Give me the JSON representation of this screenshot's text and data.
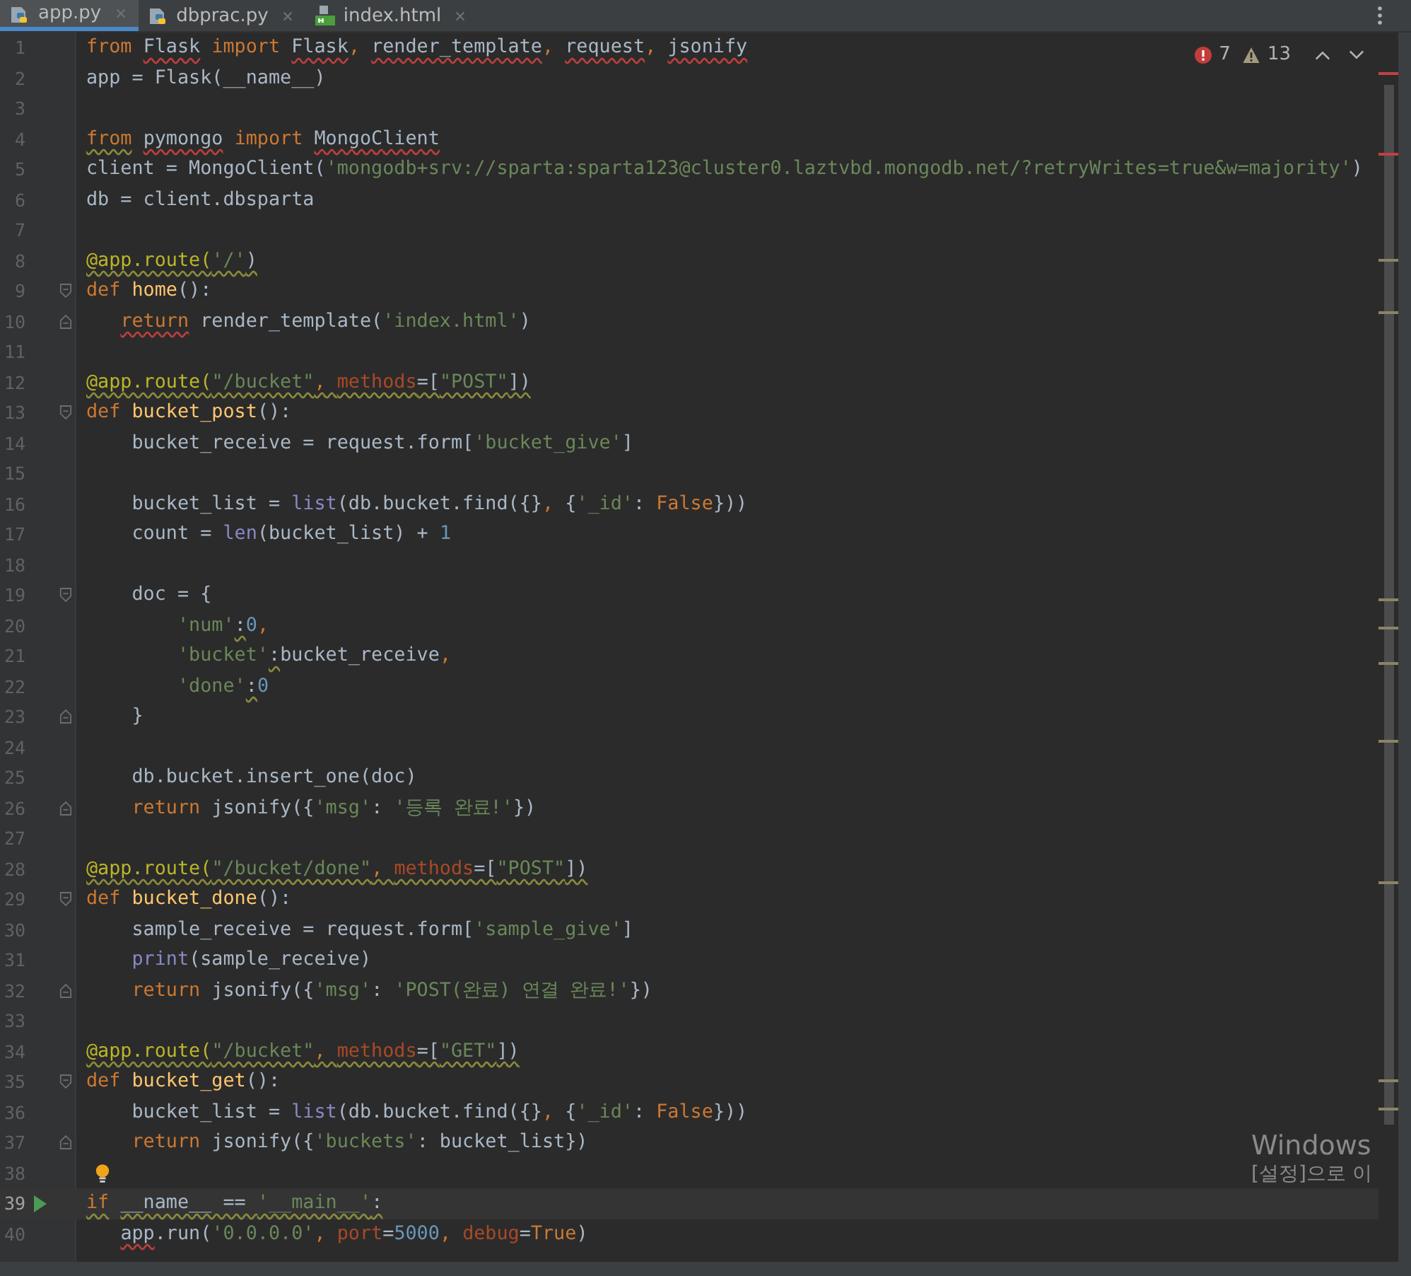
{
  "tabs": [
    {
      "label": "app.py",
      "kind": "python",
      "selected": true
    },
    {
      "label": "dbprac.py",
      "kind": "python",
      "selected": false
    },
    {
      "label": "index.html",
      "kind": "html",
      "selected": false
    }
  ],
  "inspections": {
    "errors": "7",
    "warnings": "13"
  },
  "lines": [
    {
      "number": "1",
      "current": false,
      "tokens": [
        {
          "text": "from",
          "kind": "kw"
        },
        {
          "text": " Flask",
          "kind": "plain",
          "error": true
        },
        {
          "text": " import",
          "kind": "kw"
        },
        {
          "text": " Flask",
          "kind": "plain",
          "error": true
        },
        {
          "text": ", ",
          "kind": "kw"
        },
        {
          "text": "render_template",
          "kind": "plain",
          "error": true
        },
        {
          "text": ", ",
          "kind": "kw"
        },
        {
          "text": "request",
          "kind": "plain",
          "error": true
        },
        {
          "text": ", ",
          "kind": "kw"
        },
        {
          "text": "jsonify",
          "kind": "plain",
          "error": true
        }
      ]
    },
    {
      "number": "2",
      "current": false,
      "tokens": [
        {
          "text": "app = Flask(__name__)",
          "kind": "plain"
        }
      ]
    },
    {
      "number": "3",
      "current": false
    },
    {
      "number": "4",
      "current": false,
      "tokens": [
        {
          "text": "from",
          "kind": "kw",
          "warning": true
        },
        {
          "text": " pymongo",
          "kind": "plain",
          "error": true
        },
        {
          "text": " import",
          "kind": "kw"
        },
        {
          "text": " MongoClient",
          "kind": "plain",
          "error": true
        }
      ]
    },
    {
      "number": "5",
      "current": false,
      "tokens": [
        {
          "text": "client = MongoClient(",
          "kind": "plain"
        },
        {
          "text": "'mongodb+srv://sparta:sparta123@cluster0.laztvbd.mongodb.net/?retryWrites=true&w=majority'",
          "kind": "str"
        },
        {
          "text": ")",
          "kind": "plain"
        }
      ]
    },
    {
      "number": "6",
      "current": false,
      "tokens": [
        {
          "text": "db = client.dbsparta",
          "kind": "plain"
        }
      ]
    },
    {
      "number": "7",
      "current": false
    },
    {
      "number": "8",
      "current": false,
      "tokens": [
        {
          "text": "@app.route(",
          "kind": "deco",
          "warning": true
        },
        {
          "text": "'/'",
          "kind": "str",
          "warning": true
        },
        {
          "text": ")",
          "kind": "plain",
          "warning": true
        }
      ]
    },
    {
      "number": "9",
      "current": false,
      "kind": "opener",
      "tokens": [
        {
          "text": "def",
          "kind": "kw"
        },
        {
          "text": " home",
          "kind": "fn"
        },
        {
          "text": "():",
          "kind": "plain"
        }
      ]
    },
    {
      "number": "10",
      "current": false,
      "kind": "closer",
      "tokens": [
        {
          "text": "   return",
          "kind": "kw",
          "error": true
        },
        {
          "text": " render_template(",
          "kind": "plain"
        },
        {
          "text": "'index.html'",
          "kind": "str"
        },
        {
          "text": ")",
          "kind": "plain"
        }
      ]
    },
    {
      "number": "11",
      "current": false
    },
    {
      "number": "12",
      "current": false,
      "tokens": [
        {
          "text": "@app.route(",
          "kind": "deco",
          "warning": true
        },
        {
          "text": "\"/bucket\"",
          "kind": "str",
          "warning": true
        },
        {
          "text": ", ",
          "kind": "kw",
          "warning": true
        },
        {
          "text": "methods",
          "kind": "param",
          "warning": true
        },
        {
          "text": "=[",
          "kind": "plain",
          "warning": true
        },
        {
          "text": "\"POST\"",
          "kind": "str",
          "warning": true
        },
        {
          "text": "])",
          "kind": "plain",
          "warning": true
        }
      ]
    },
    {
      "number": "13",
      "current": false,
      "kind": "opener",
      "tokens": [
        {
          "text": "def",
          "kind": "kw"
        },
        {
          "text": " bucket_post",
          "kind": "fn"
        },
        {
          "text": "():",
          "kind": "plain"
        }
      ]
    },
    {
      "number": "14",
      "current": false,
      "tokens": [
        {
          "text": "    bucket_receive = request.form[",
          "kind": "plain"
        },
        {
          "text": "'bucket_give'",
          "kind": "str"
        },
        {
          "text": "]",
          "kind": "plain"
        }
      ]
    },
    {
      "number": "15",
      "current": false
    },
    {
      "number": "16",
      "current": false,
      "tokens": [
        {
          "text": "    bucket_list = ",
          "kind": "plain"
        },
        {
          "text": "list",
          "kind": "builtin"
        },
        {
          "text": "(db.bucket.find({}",
          "kind": "plain"
        },
        {
          "text": ", ",
          "kind": "kw"
        },
        {
          "text": "{",
          "kind": "plain"
        },
        {
          "text": "'_id'",
          "kind": "str"
        },
        {
          "text": ": ",
          "kind": "plain"
        },
        {
          "text": "False",
          "kind": "kw"
        },
        {
          "text": "}))",
          "kind": "plain"
        }
      ]
    },
    {
      "number": "17",
      "current": false,
      "tokens": [
        {
          "text": "    count = ",
          "kind": "plain"
        },
        {
          "text": "len",
          "kind": "builtin"
        },
        {
          "text": "(bucket_list) + ",
          "kind": "plain"
        },
        {
          "text": "1",
          "kind": "num"
        }
      ]
    },
    {
      "number": "18",
      "current": false
    },
    {
      "number": "19",
      "current": false,
      "kind": "opener",
      "tokens": [
        {
          "text": "    doc = {",
          "kind": "plain"
        }
      ]
    },
    {
      "number": "20",
      "current": false,
      "tokens": [
        {
          "text": "        'num'",
          "kind": "str"
        },
        {
          "text": ":",
          "kind": "plain",
          "warning": true
        },
        {
          "text": "0",
          "kind": "num"
        },
        {
          "text": ",",
          "kind": "kw"
        }
      ]
    },
    {
      "number": "21",
      "current": false,
      "tokens": [
        {
          "text": "        'bucket'",
          "kind": "str"
        },
        {
          "text": ":",
          "kind": "plain",
          "warning": true
        },
        {
          "text": "bucket_receive",
          "kind": "plain"
        },
        {
          "text": ",",
          "kind": "kw"
        }
      ]
    },
    {
      "number": "22",
      "current": false,
      "tokens": [
        {
          "text": "        'done'",
          "kind": "str"
        },
        {
          "text": ":",
          "kind": "plain",
          "warning": true
        },
        {
          "text": "0",
          "kind": "num"
        }
      ]
    },
    {
      "number": "23",
      "current": false,
      "kind": "closer",
      "tokens": [
        {
          "text": "    }",
          "kind": "plain"
        }
      ]
    },
    {
      "number": "24",
      "current": false
    },
    {
      "number": "25",
      "current": false,
      "tokens": [
        {
          "text": "    db.bucket.insert_one(doc)",
          "kind": "plain"
        }
      ]
    },
    {
      "number": "26",
      "current": false,
      "kind": "closer",
      "tokens": [
        {
          "text": "    return",
          "kind": "kw"
        },
        {
          "text": " jsonify({",
          "kind": "plain"
        },
        {
          "text": "'msg'",
          "kind": "str"
        },
        {
          "text": ": ",
          "kind": "plain"
        },
        {
          "text": "'등록 완료!'",
          "kind": "str"
        },
        {
          "text": "})",
          "kind": "plain"
        }
      ]
    },
    {
      "number": "27",
      "current": false
    },
    {
      "number": "28",
      "current": false,
      "tokens": [
        {
          "text": "@app.route(",
          "kind": "deco",
          "warning": true
        },
        {
          "text": "\"/bucket/done\"",
          "kind": "str",
          "warning": true
        },
        {
          "text": ", ",
          "kind": "kw",
          "warning": true
        },
        {
          "text": "methods",
          "kind": "param",
          "warning": true
        },
        {
          "text": "=[",
          "kind": "plain",
          "warning": true
        },
        {
          "text": "\"POST\"",
          "kind": "str",
          "warning": true
        },
        {
          "text": "])",
          "kind": "plain",
          "warning": true
        }
      ]
    },
    {
      "number": "29",
      "current": false,
      "kind": "opener",
      "tokens": [
        {
          "text": "def",
          "kind": "kw"
        },
        {
          "text": " bucket_done",
          "kind": "fn"
        },
        {
          "text": "():",
          "kind": "plain"
        }
      ]
    },
    {
      "number": "30",
      "current": false,
      "tokens": [
        {
          "text": "    sample_receive = request.form[",
          "kind": "plain"
        },
        {
          "text": "'sample_give'",
          "kind": "str"
        },
        {
          "text": "]",
          "kind": "plain"
        }
      ]
    },
    {
      "number": "31",
      "current": false,
      "tokens": [
        {
          "text": "    print",
          "kind": "builtin"
        },
        {
          "text": "(sample_receive)",
          "kind": "plain"
        }
      ]
    },
    {
      "number": "32",
      "current": false,
      "kind": "closer",
      "tokens": [
        {
          "text": "    return",
          "kind": "kw"
        },
        {
          "text": " jsonify({",
          "kind": "plain"
        },
        {
          "text": "'msg'",
          "kind": "str"
        },
        {
          "text": ": ",
          "kind": "plain"
        },
        {
          "text": "'POST(완료) 연결 완료!'",
          "kind": "str"
        },
        {
          "text": "})",
          "kind": "plain"
        }
      ]
    },
    {
      "number": "33",
      "current": false
    },
    {
      "number": "34",
      "current": false,
      "tokens": [
        {
          "text": "@app.route(",
          "kind": "deco",
          "warning": true
        },
        {
          "text": "\"/bucket\"",
          "kind": "str",
          "warning": true
        },
        {
          "text": ", ",
          "kind": "kw",
          "warning": true
        },
        {
          "text": "methods",
          "kind": "param",
          "warning": true
        },
        {
          "text": "=[",
          "kind": "plain",
          "warning": true
        },
        {
          "text": "\"GET\"",
          "kind": "str",
          "warning": true
        },
        {
          "text": "])",
          "kind": "plain",
          "warning": true
        }
      ]
    },
    {
      "number": "35",
      "current": false,
      "kind": "opener",
      "tokens": [
        {
          "text": "def",
          "kind": "kw"
        },
        {
          "text": " bucket_get",
          "kind": "fn"
        },
        {
          "text": "():",
          "kind": "plain"
        }
      ]
    },
    {
      "number": "36",
      "current": false,
      "tokens": [
        {
          "text": "    bucket_list = ",
          "kind": "plain"
        },
        {
          "text": "list",
          "kind": "builtin"
        },
        {
          "text": "(db.bucket.find({}",
          "kind": "plain"
        },
        {
          "text": ", ",
          "kind": "kw"
        },
        {
          "text": "{",
          "kind": "plain"
        },
        {
          "text": "'_id'",
          "kind": "str"
        },
        {
          "text": ": ",
          "kind": "plain"
        },
        {
          "text": "False",
          "kind": "kw"
        },
        {
          "text": "}))",
          "kind": "plain"
        }
      ]
    },
    {
      "number": "37",
      "current": false,
      "kind": "closer",
      "tokens": [
        {
          "text": "    return",
          "kind": "kw"
        },
        {
          "text": " jsonify({",
          "kind": "plain"
        },
        {
          "text": "'buckets'",
          "kind": "str"
        },
        {
          "text": ": bucket_list})",
          "kind": "plain"
        }
      ]
    },
    {
      "number": "38",
      "current": false,
      "kind": "bulb"
    },
    {
      "number": "39",
      "current": true,
      "kind": "run",
      "tokens": [
        {
          "text": "if",
          "kind": "kw",
          "warning": true
        },
        {
          "text": " __name__ == ",
          "kind": "plain",
          "warning": true
        },
        {
          "text": "'__main__'",
          "kind": "str",
          "warning": true
        },
        {
          "text": ":",
          "kind": "plain",
          "warning": true
        }
      ]
    },
    {
      "number": "40",
      "current": false,
      "tokens": [
        {
          "text": "   app",
          "kind": "plain",
          "error": true
        },
        {
          "text": ".run(",
          "kind": "plain"
        },
        {
          "text": "'0.0.0.0'",
          "kind": "str"
        },
        {
          "text": ", ",
          "kind": "kw"
        },
        {
          "text": "port",
          "kind": "param"
        },
        {
          "text": "=",
          "kind": "plain"
        },
        {
          "text": "5000",
          "kind": "num"
        },
        {
          "text": ", ",
          "kind": "kw"
        },
        {
          "text": "debug",
          "kind": "param"
        },
        {
          "text": "=",
          "kind": "plain"
        },
        {
          "text": "True",
          "kind": "kw"
        },
        {
          "text": ")",
          "kind": "plain"
        }
      ]
    }
  ],
  "os_notice": [
    "Windows",
    "[설정]으로 이"
  ]
}
